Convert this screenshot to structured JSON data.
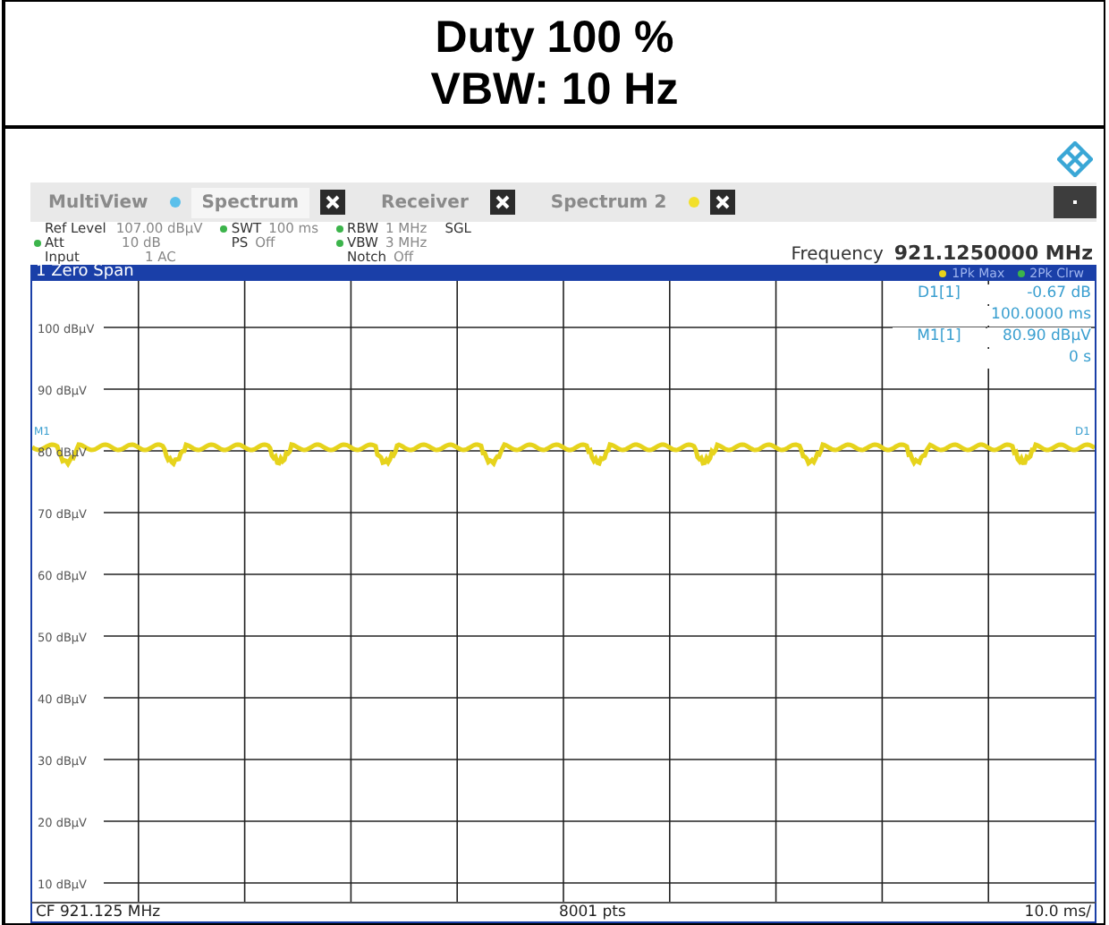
{
  "header": {
    "lines": [
      "Duty 100 %",
      "VBW: 10 Hz"
    ]
  },
  "tabs": [
    {
      "label": "MultiView",
      "color": "#5bc0eb",
      "closable": false,
      "selected": false
    },
    {
      "label": "Spectrum",
      "closable": true,
      "selected": true
    },
    {
      "label": "Receiver",
      "closable": true,
      "selected": false
    },
    {
      "label": "Spectrum 2",
      "color": "#f2e02a",
      "closable": true,
      "selected": false
    }
  ],
  "params": [
    [
      {
        "label": "Ref Level",
        "value": "107.00 dBµV",
        "dot": false
      },
      {
        "label": "Att",
        "value": "10 dB",
        "dot": true
      },
      {
        "label": "Input",
        "value": "1 AC",
        "dot": false
      }
    ],
    [
      {
        "label": "SWT",
        "value": "100 ms",
        "dot": true
      },
      {
        "label": "PS",
        "value": "Off",
        "dot": false
      }
    ],
    [
      {
        "label": "RBW",
        "value": "1 MHz",
        "dot": true
      },
      {
        "label": "VBW",
        "value": "3 MHz",
        "dot": true
      },
      {
        "label": "Notch",
        "value": "Off",
        "dot": false
      }
    ]
  ],
  "mode": "SGL",
  "frequency": {
    "label": "Frequency",
    "value": "921.1250000 MHz"
  },
  "window": {
    "title": "1 Zero Span",
    "traces": [
      {
        "label": "1Pk Max",
        "color": "#e8d21a"
      },
      {
        "label": "2Pk Clrw",
        "color": "#3cb44b"
      }
    ]
  },
  "plot": {
    "y_labels": [
      "100 dBµV",
      "90 dBµV",
      "80 dBµV",
      "70 dBµV",
      "60 dBµV",
      "50 dBµV",
      "40 dBµV",
      "30 dBµV",
      "20 dBµV",
      "10 dBµV"
    ],
    "trace_markers": [
      "M1",
      "D1"
    ],
    "readouts": [
      {
        "name": "D1[1]",
        "value": "-0.67 dB",
        "sub": "100.0000 ms"
      },
      {
        "name": "M1[1]",
        "value": "80.90 dBµV",
        "sub": "0 s"
      }
    ]
  },
  "footer": {
    "left": "CF 921.125 MHz",
    "center": "8001 pts",
    "right": "10.0 ms/"
  }
}
